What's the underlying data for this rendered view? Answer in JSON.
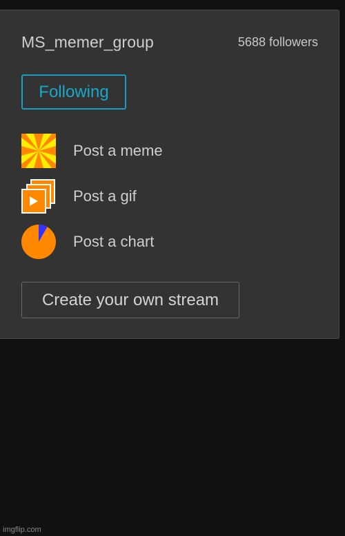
{
  "group": {
    "name": "MS_memer_group",
    "followers": "5688 followers"
  },
  "follow_button": {
    "label": "Following"
  },
  "actions": [
    {
      "label": "Post a meme",
      "icon": "meme-pinwheel-icon"
    },
    {
      "label": "Post a gif",
      "icon": "gif-stack-icon"
    },
    {
      "label": "Post a chart",
      "icon": "pie-chart-icon"
    }
  ],
  "create_stream": {
    "label": "Create your own stream"
  },
  "watermark": "imgflip.com",
  "colors": {
    "page_background": "#111111",
    "panel_background": "#333333",
    "accent": "#1aa7cc",
    "icon_orange": "#ff8800",
    "icon_yellow": "#ffee00",
    "icon_blue": "#3333ff"
  }
}
